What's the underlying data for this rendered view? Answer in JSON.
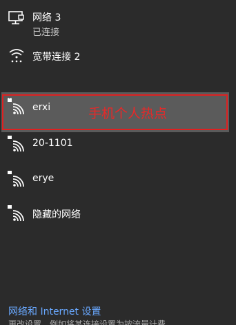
{
  "networks": {
    "wired": {
      "name": "网络 3",
      "status": "已连接",
      "icon": "monitor-network-icon"
    },
    "broadband": {
      "name": "宽带连接 2",
      "icon": "dialup-connection-icon"
    },
    "wifi": [
      {
        "name": "erxi",
        "icon": "wifi-secured-icon",
        "selected": true
      },
      {
        "name": "20-1101",
        "icon": "wifi-secured-icon"
      },
      {
        "name": "erye",
        "icon": "wifi-secured-icon"
      },
      {
        "name": "隐藏的网络",
        "icon": "wifi-secured-icon"
      }
    ]
  },
  "annotation": {
    "text": "手机个人热点",
    "color": "#e02020"
  },
  "footer": {
    "settings_link": "网络和 Internet 设置",
    "settings_sub": "更改设置，例如将某连接设置为按流量计费。"
  },
  "colors": {
    "background": "#2b2b2b",
    "selected": "#5b5b5b",
    "link": "#69a8ff"
  }
}
